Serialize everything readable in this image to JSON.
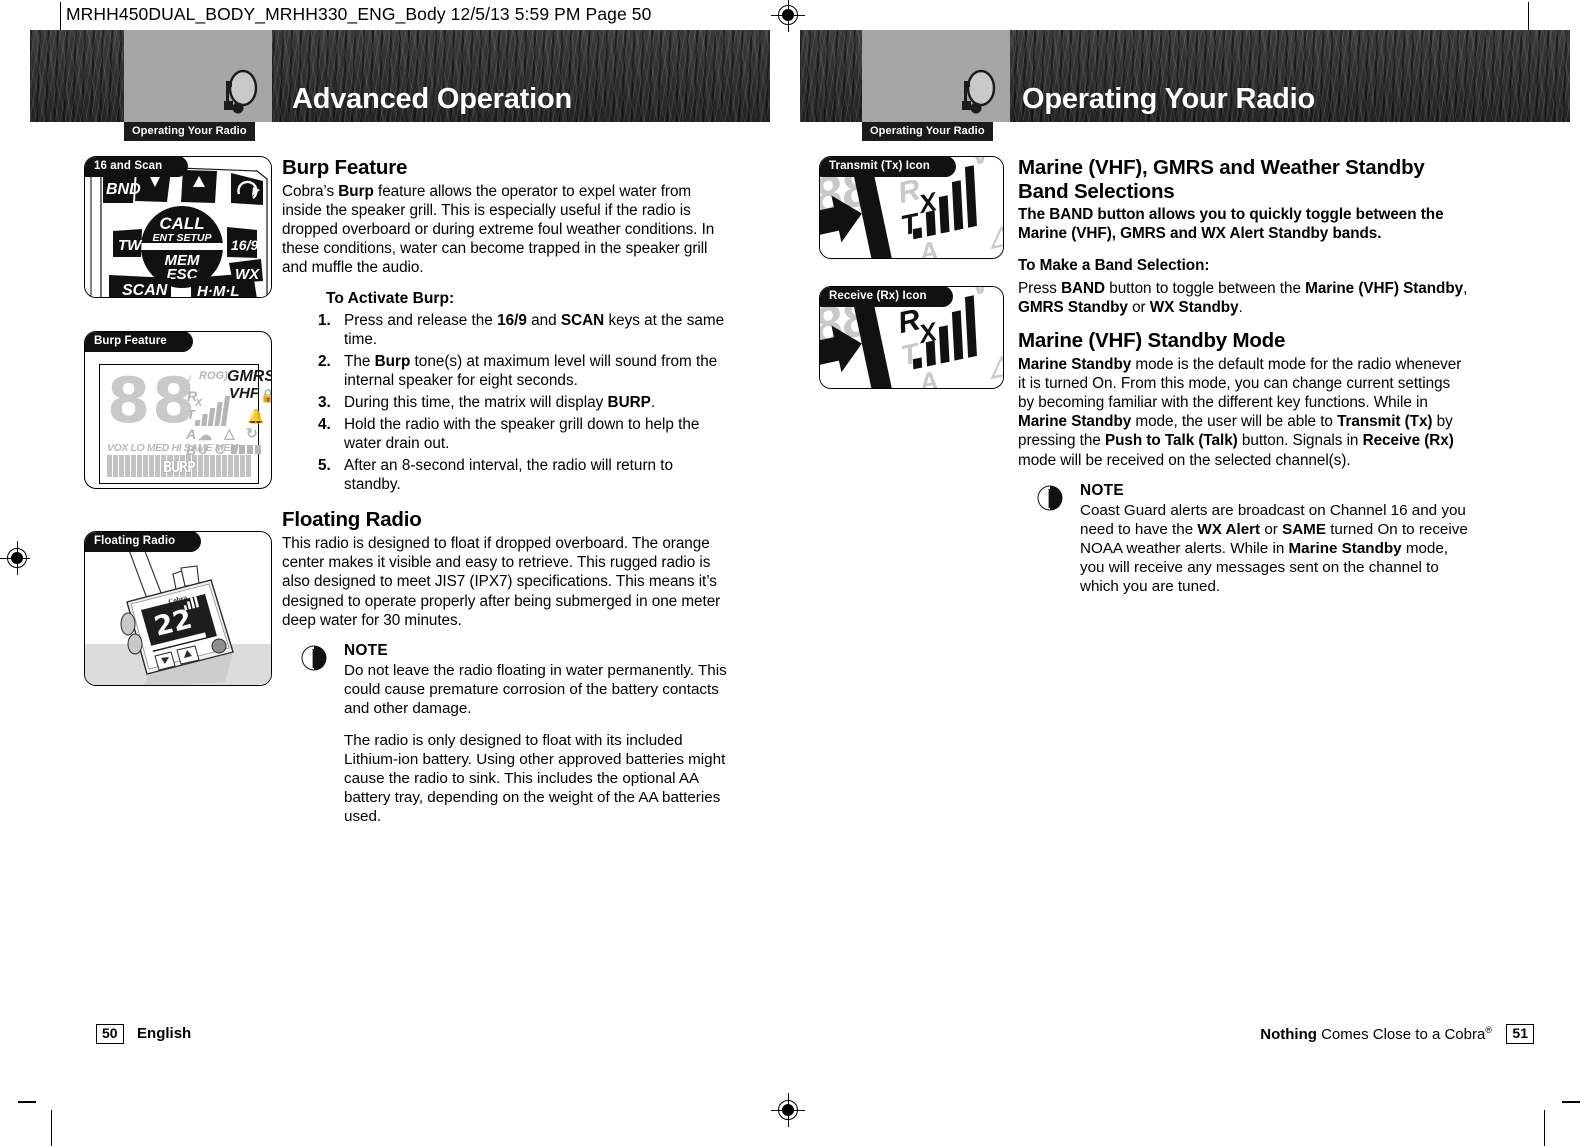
{
  "print_slug": "MRHH450DUAL_BODY_MRHH330_ENG_Body  12/5/13  5:59 PM  Page 50",
  "colors": {
    "header_band": "#2e2e2e",
    "header_grey_box": "#a6a6a6",
    "tab_black": "#1b1b1b",
    "page_white": "#ffffff",
    "lcd_inactive_segment": "#c9c9c9"
  },
  "left_page": {
    "header": {
      "title": "Advanced Operation",
      "tab_label": "Operating Your Radio",
      "radio_icon": "handheld-radio-icon"
    },
    "figures": [
      {
        "label": "16 and Scan",
        "keys": [
          "BND",
          "CALL",
          "ENT",
          "SETUP",
          "TW",
          "16/9",
          "MEM",
          "ESC",
          "SCAN",
          "H·M·L",
          "WX"
        ]
      },
      {
        "label": "Burp Feature",
        "lcd": {
          "digits": "88",
          "indicators_top": [
            "ROG)",
            "GMRS",
            "VHF"
          ],
          "indicators_left": [
            "R",
            "X",
            "T"
          ],
          "indicators_mid": [
            "A",
            "B",
            "U",
            "C"
          ],
          "indicators_bottom": "VOX LO MED HI SAME MEM",
          "matrix_text": "BURP"
        }
      },
      {
        "label": "Floating Radio"
      }
    ],
    "sections": [
      {
        "heading": "Burp Feature",
        "paragraph_runs": [
          {
            "t": "Cobra’s "
          },
          {
            "t": "Burp",
            "b": true
          },
          {
            "t": " feature allows the operator to expel water from inside the speaker grill. This is especially useful if the radio is dropped overboard or during extreme foul weather conditions. In these conditions, water can become trapped in the speaker grill and muffle the audio."
          }
        ],
        "step_head": "To Activate Burp:",
        "steps": [
          {
            "num": "1.",
            "runs": [
              {
                "t": "Press and release the "
              },
              {
                "t": "16/9",
                "b": true
              },
              {
                "t": " and "
              },
              {
                "t": "SCAN",
                "b": true
              },
              {
                "t": " keys at the same time."
              }
            ]
          },
          {
            "num": "2.",
            "runs": [
              {
                "t": "The "
              },
              {
                "t": "Burp",
                "b": true
              },
              {
                "t": " tone(s) at maximum level will sound from the internal speaker for eight seconds."
              }
            ]
          },
          {
            "num": "3.",
            "runs": [
              {
                "t": "During this time, the matrix will display "
              },
              {
                "t": "BURP",
                "b": true
              },
              {
                "t": "."
              }
            ]
          },
          {
            "num": "4.",
            "runs": [
              {
                "t": "Hold the radio with the speaker grill down to help the water drain out."
              }
            ]
          },
          {
            "num": "5.",
            "runs": [
              {
                "t": "After an 8-second interval, the radio will return to standby."
              }
            ]
          }
        ]
      },
      {
        "heading": "Floating Radio",
        "paragraph_runs": [
          {
            "t": "This radio is designed to float if dropped overboard. The orange center makes it visible and easy to retrieve. This rugged radio is also designed to meet JIS7 (IPX7) specifications. This means it’s designed to operate properly after being submerged in one meter deep water for 30 minutes."
          }
        ],
        "note": {
          "icon": "cobra-note-icon",
          "title": "NOTE",
          "paragraphs": [
            "Do not leave the radio floating in water permanently. This could cause premature corrosion of the battery contacts and other damage.",
            "The radio is only designed to float with its included Lithium-ion battery. Using other approved batteries might cause the radio to sink. This includes the optional AA battery tray, depending on the weight of the AA batteries used."
          ]
        }
      }
    ],
    "footer": {
      "page_number": "50",
      "language": "English"
    }
  },
  "right_page": {
    "header": {
      "title": "Operating Your Radio",
      "tab_label": "Operating Your Radio",
      "radio_icon": "handheld-radio-icon"
    },
    "figures": [
      {
        "label": "Transmit (Tx) Icon",
        "active": "TX"
      },
      {
        "label": "Receive (Rx) Icon",
        "active": "RX"
      }
    ],
    "sections": [
      {
        "heading": "Marine (VHF), GMRS and Weather Standby Band Selections",
        "lead_bold": "The BAND button allows you to quickly toggle between the Marine (VHF), GMRS and WX Alert Standby bands.",
        "sub_head": "To Make a Band Selection:",
        "sub_runs": [
          {
            "t": "Press "
          },
          {
            "t": "BAND",
            "b": true
          },
          {
            "t": " button to toggle between the "
          },
          {
            "t": "Marine (VHF) Standby",
            "b": true
          },
          {
            "t": ", "
          },
          {
            "t": "GMRS Standby",
            "b": true
          },
          {
            "t": " or "
          },
          {
            "t": "WX Standby",
            "b": true
          },
          {
            "t": "."
          }
        ]
      },
      {
        "heading": "Marine (VHF) Standby Mode",
        "paragraph_runs": [
          {
            "t": "Marine Standby",
            "b": true
          },
          {
            "t": " mode is the default mode for the radio whenever it is turned On. From this mode, you can change current settings by becoming familiar with the different key functions. While in "
          },
          {
            "t": "Marine Standby",
            "b": true
          },
          {
            "t": " mode, the user will be able to "
          },
          {
            "t": "Transmit (Tx)",
            "b": true
          },
          {
            "t": " by pressing the "
          },
          {
            "t": "Push to Talk (Talk)",
            "b": true
          },
          {
            "t": " button. Signals in "
          },
          {
            "t": "Receive (Rx)",
            "b": true
          },
          {
            "t": " mode will be received on the selected channel(s)."
          }
        ],
        "note": {
          "icon": "cobra-note-icon",
          "title": "NOTE",
          "runs": [
            {
              "t": "Coast Guard alerts are broadcast on Channel 16 and you need to have the "
            },
            {
              "t": "WX Alert",
              "b": true
            },
            {
              "t": " or "
            },
            {
              "t": "SAME",
              "b": true
            },
            {
              "t": " turned On to receive NOAA weather alerts. While in "
            },
            {
              "t": "Marine Standby",
              "b": true
            },
            {
              "t": " mode, you will receive any messages sent on the channel to which you are tuned."
            }
          ]
        }
      }
    ],
    "footer": {
      "page_number": "51",
      "tagline_bold": "Nothing",
      "tagline_rest": " Comes Close to a Cobra",
      "tagline_sup": "®"
    }
  }
}
